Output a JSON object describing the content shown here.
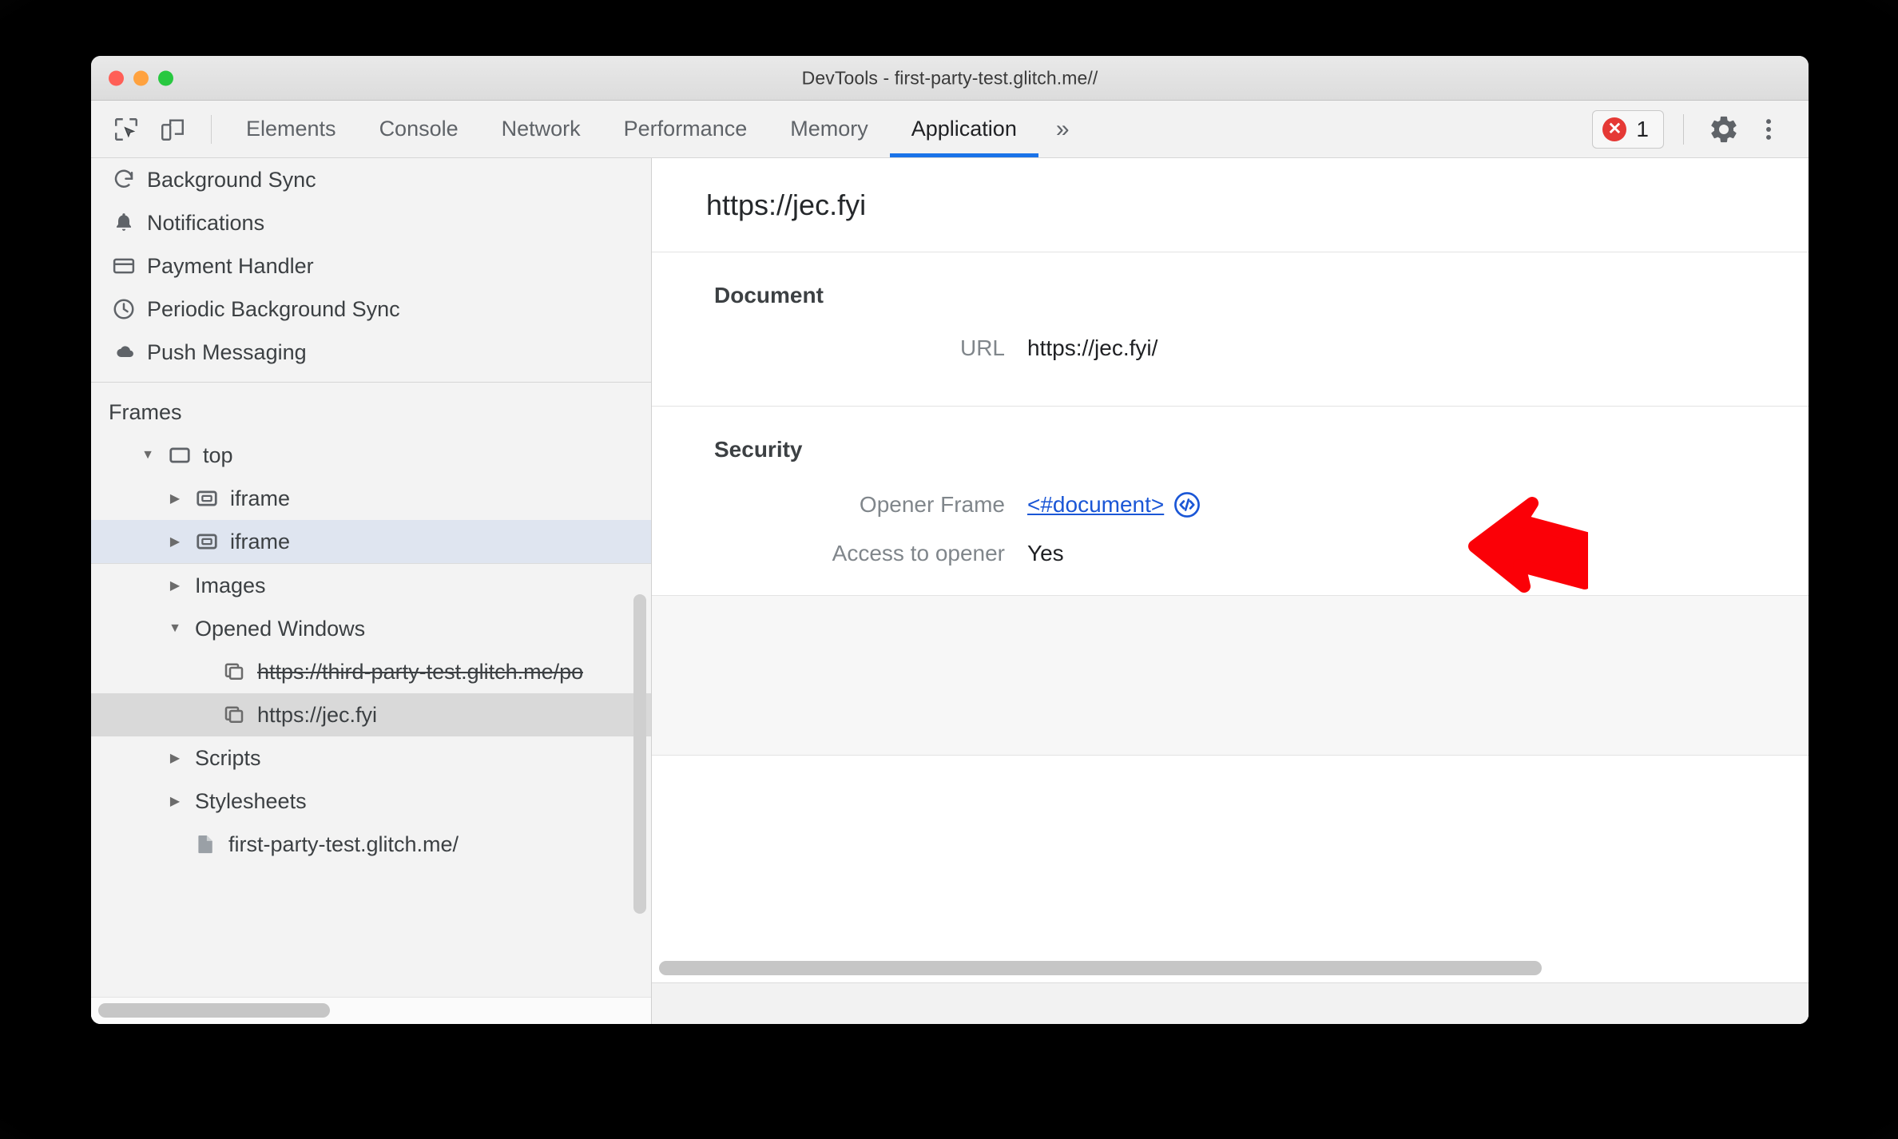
{
  "window": {
    "title": "DevTools - first-party-test.glitch.me//"
  },
  "toolbar": {
    "inspect_icon": "inspect-cursor-icon",
    "device_icon": "device-toolbar-icon",
    "tabs": [
      {
        "label": "Elements",
        "active": false
      },
      {
        "label": "Console",
        "active": false
      },
      {
        "label": "Network",
        "active": false
      },
      {
        "label": "Performance",
        "active": false
      },
      {
        "label": "Memory",
        "active": false
      },
      {
        "label": "Application",
        "active": true
      }
    ],
    "more_tabs_label": "»",
    "error_count": "1",
    "error_icon": "error-circle-x-icon",
    "settings_icon": "gear-icon",
    "menu_icon": "kebab-menu-icon",
    "accent_color": "#1a73e8",
    "error_color": "#e53935"
  },
  "sidebar": {
    "service_items": [
      {
        "label": "Background Sync",
        "icon": "sync-icon"
      },
      {
        "label": "Notifications",
        "icon": "bell-icon"
      },
      {
        "label": "Payment Handler",
        "icon": "credit-card-icon"
      },
      {
        "label": "Periodic Background Sync",
        "icon": "clock-icon"
      },
      {
        "label": "Push Messaging",
        "icon": "cloud-icon"
      }
    ],
    "frames_title": "Frames",
    "frames": [
      {
        "label": "top",
        "icon": "frame-icon",
        "twisty": "down",
        "indent": 1,
        "selected": "none",
        "strike": false
      },
      {
        "label": "iframe",
        "icon": "iframe-icon",
        "twisty": "right",
        "indent": 2,
        "selected": "none",
        "strike": false
      },
      {
        "label": "iframe",
        "icon": "iframe-icon",
        "twisty": "right",
        "indent": 2,
        "selected": "blue",
        "strike": false
      },
      {
        "label": "Images",
        "icon": "none",
        "twisty": "right",
        "indent": 2,
        "selected": "none",
        "strike": false
      },
      {
        "label": "Opened Windows",
        "icon": "none",
        "twisty": "down",
        "indent": 2,
        "selected": "none",
        "strike": false
      },
      {
        "label": "https://third-party-test.glitch.me/po",
        "icon": "window-icon",
        "twisty": "none",
        "indent": 3,
        "selected": "none",
        "strike": true
      },
      {
        "label": "https://jec.fyi",
        "icon": "window-icon",
        "twisty": "none",
        "indent": 3,
        "selected": "grey",
        "strike": false
      },
      {
        "label": "Scripts",
        "icon": "none",
        "twisty": "right",
        "indent": 2,
        "selected": "none",
        "strike": false
      },
      {
        "label": "Stylesheets",
        "icon": "none",
        "twisty": "right",
        "indent": 2,
        "selected": "none",
        "strike": false
      },
      {
        "label": "first-party-test.glitch.me/",
        "icon": "document-icon",
        "twisty": "none",
        "indent": 3,
        "selected": "none",
        "strike": false
      }
    ]
  },
  "main": {
    "url_heading": "https://jec.fyi",
    "document_section": {
      "title": "Document",
      "rows": [
        {
          "key": "URL",
          "value": "https://jec.fyi/"
        }
      ]
    },
    "security_section": {
      "title": "Security",
      "opener_frame_key": "Opener Frame",
      "opener_frame_value": "<#document>",
      "opener_frame_icon": "code-circle-icon",
      "access_key": "Access to opener",
      "access_value": "Yes",
      "link_color": "#1a56d6"
    }
  },
  "annotation": {
    "arrow_name": "red-pointer-arrow",
    "arrow_color": "#fb0007"
  }
}
